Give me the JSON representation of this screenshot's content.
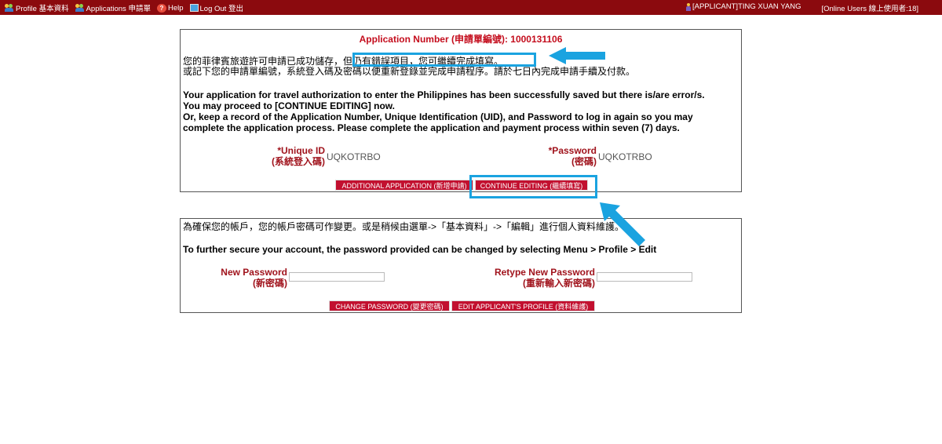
{
  "topbar": {
    "profile": "Profile 基本資料",
    "applications": "Applications 申請單",
    "help": "Help",
    "logout": "Log Out 登出",
    "user": "[APPLICANT]TING XUAN YANG",
    "online": "[Online Users 線上使用者:18]"
  },
  "result": {
    "app_number": "Application Number (申請單編號): 1000131106",
    "zh_line1a": "您的菲律賓旅遊許可申請已成功儲存，",
    "zh_line1b": "但仍有錯誤項目，您可繼續完成填寫。",
    "zh_line2": "或記下您的申請單編號，系統登入碼及密碼以便重新登錄並完成申請程序。請於七日內完成申請手續及付款。",
    "en_line1": "Your application for travel authorization to enter the Philippines has been successfully saved but there is/are error/s.",
    "en_line2": "You may proceed to [CONTINUE EDITING] now.",
    "en_line3": "Or, keep a record of the Application Number, Unique Identification (UID), and Password to log in again so you may",
    "en_line4": "complete the application process. Please complete the application and payment process within seven (7) days.",
    "uid_label": "*Unique ID",
    "uid_label_zh": "(系統登入碼)",
    "uid_value": "UQKOTRBO",
    "pw_label": "*Password",
    "pw_label_zh": "(密碼)",
    "pw_value": "UQKOTRBO",
    "btn_additional": "ADDITIONAL APPLICATION (新增申請)",
    "btn_continue": "CONTINUE EDITING (繼續填寫)"
  },
  "security": {
    "zh_text": "為確保您的帳戶，您的帳戶密碼可作變更。或是稍候由選單->「基本資料」->「編輯」進行個人資料維護。",
    "en_text": "To further secure your account, the password provided can be changed by selecting Menu > Profile > Edit",
    "new_pw_label": "New Password",
    "new_pw_label_zh": "(新密碼)",
    "new_pw_value": "",
    "retype_label": "Retype New Password",
    "retype_label_zh": "(重新輸入新密碼)",
    "retype_value": "",
    "btn_change": "CHANGE PASSWORD (變更密碼)",
    "btn_edit_profile": "EDIT APPLICANT'S PROFILE (資料維護)"
  },
  "colors": {
    "topbar": "#8b0a0e",
    "button": "#c2102f",
    "label_red": "#a0131c",
    "highlight": "#1aa3e0"
  }
}
